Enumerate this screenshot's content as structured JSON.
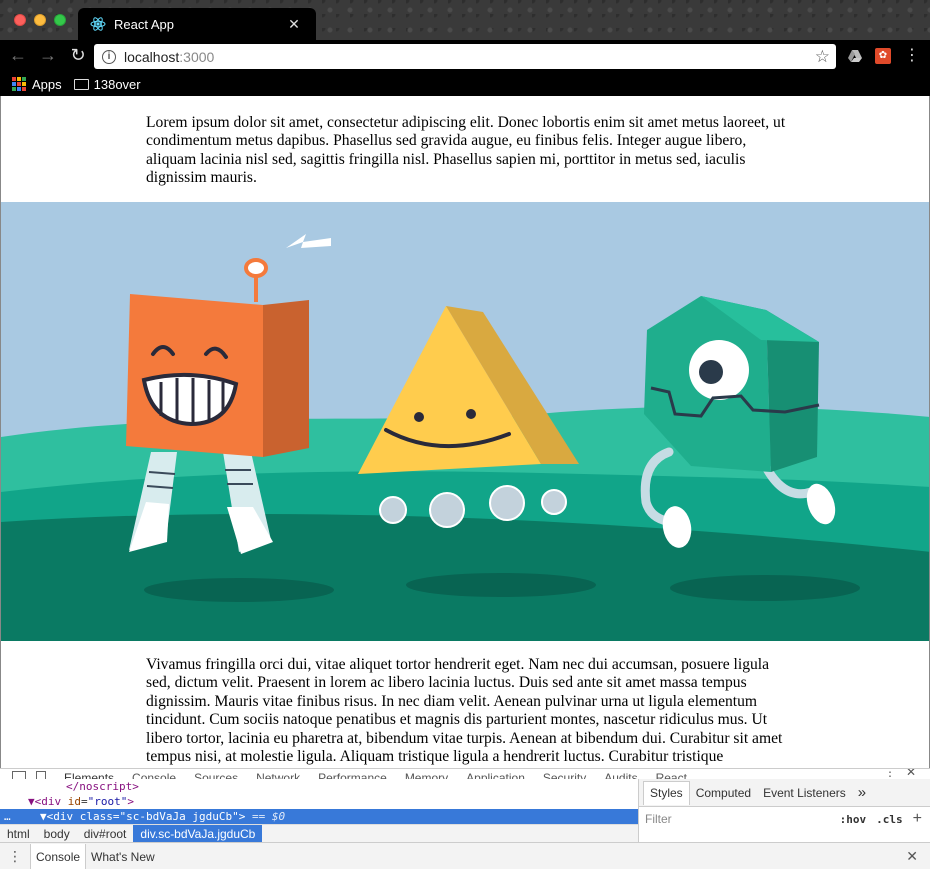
{
  "browser": {
    "tab_title": "React App",
    "url_host": "localhost",
    "url_port": ":3000",
    "bookmarks": [
      {
        "label": "Apps"
      },
      {
        "label": "138over"
      }
    ]
  },
  "page": {
    "paragraph_1": "Lorem ipsum dolor sit amet, consectetur adipiscing elit. Donec lobortis enim sit amet metus laoreet, ut condimentum metus dapibus. Phasellus sed gravida augue, eu finibus felis. Integer augue libero, aliquam lacinia nisl sed, sagittis fringilla nisl. Phasellus sapien mi, porttitor in metus sed, iaculis dignissim mauris.",
    "paragraph_2": "Vivamus fringilla orci dui, vitae aliquet tortor hendrerit eget. Nam nec dui accumsan, posuere ligula sed, dictum velit. Praesent in lorem ac libero lacinia luctus. Duis sed ante sit amet massa tempus dignissim. Mauris vitae finibus risus. In nec diam velit. Aenean pulvinar urna ut ligula elementum tincidunt. Cum sociis natoque penatibus et magnis dis parturient montes, nascetur ridiculus mus. Ut libero tortor, lacinia eu pharetra at, bibendum vitae turpis. Aenean at bibendum dui. Curabitur sit amet tempus nisi, at molestie ligula. Aliquam tristique ligula a hendrerit luctus. Curabitur tristique"
  },
  "devtools": {
    "tabs": [
      "Elements",
      "Console",
      "Sources",
      "Network",
      "Performance",
      "Memory",
      "Application",
      "Security",
      "Audits",
      "React"
    ],
    "dom_lines": [
      {
        "open": "</",
        "tag": "noscript",
        "close": ">"
      },
      {
        "tag": "div",
        "attr": "id",
        "val": "root"
      },
      {
        "tag": "div",
        "attr": "class",
        "val": "sc-bdVaJa jgduCb",
        "suffix": " == $0"
      }
    ],
    "breadcrumbs": [
      "html",
      "body",
      "div#root",
      "div.sc-bdVaJa.jgduCb"
    ],
    "styles_tabs": [
      "Styles",
      "Computed",
      "Event Listeners"
    ],
    "styles_more": "»",
    "filter_placeholder": "Filter",
    "filter_hov": ":hov",
    "filter_cls": ".cls",
    "drawer_tabs": [
      "Console",
      "What's New"
    ]
  },
  "colors": {
    "sky": "#a9c9e2",
    "hill_light": "#2fbf9f",
    "hill_mid": "#11a589",
    "ground": "#0a7a63",
    "orange_robot": "#f47a3c",
    "triangle": "#ffcc4d",
    "hexagon": "#1fae8d",
    "selection": "#3879d9"
  },
  "icons": [
    "back-arrow-icon",
    "forward-arrow-icon",
    "reload-icon",
    "info-icon",
    "star-icon",
    "drive-icon",
    "extension-icon",
    "menu-dots-icon",
    "apps-grid-icon",
    "folder-icon",
    "react-favicon-icon",
    "close-icon",
    "inspect-icon",
    "device-icon"
  ]
}
